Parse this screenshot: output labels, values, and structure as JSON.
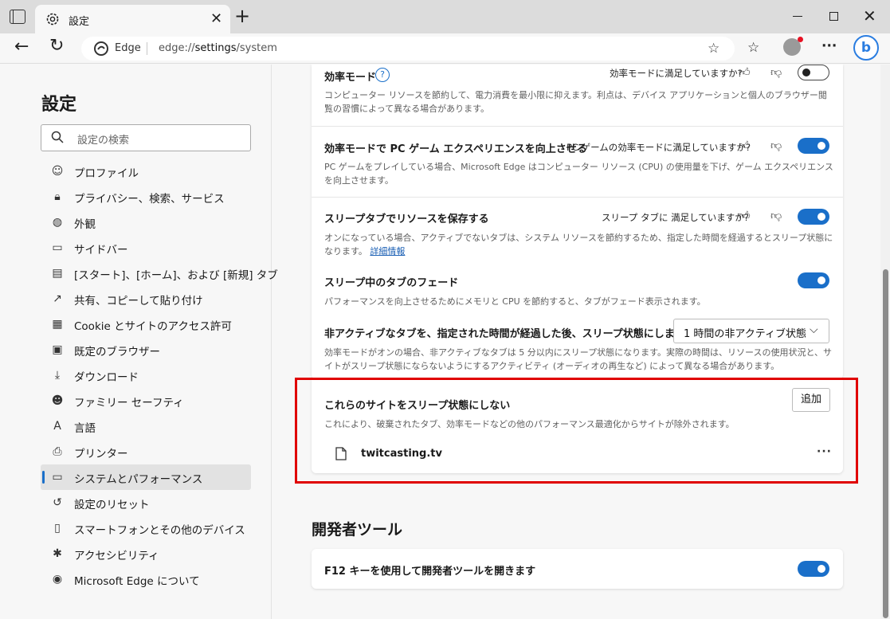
{
  "tab": {
    "title": "設定"
  },
  "address": {
    "site": "Edge",
    "url_prefix": "edge://",
    "url_main": "settings",
    "url_suffix": "/system"
  },
  "sidebar": {
    "title": "設定",
    "search_placeholder": "設定の検索",
    "items": [
      {
        "label": "プロファイル",
        "icon": "profile-icon"
      },
      {
        "label": "プライバシー、検索、サービス",
        "icon": "lock-icon"
      },
      {
        "label": "外観",
        "icon": "palette-icon"
      },
      {
        "label": "サイドバー",
        "icon": "sidebar-icon"
      },
      {
        "label": "[スタート]、[ホーム]、および [新規] タブ",
        "icon": "home-tabs-icon"
      },
      {
        "label": "共有、コピーして貼り付け",
        "icon": "share-icon"
      },
      {
        "label": "Cookie とサイトのアクセス許可",
        "icon": "cookie-icon"
      },
      {
        "label": "既定のブラウザー",
        "icon": "browser-icon"
      },
      {
        "label": "ダウンロード",
        "icon": "download-icon"
      },
      {
        "label": "ファミリー セーフティ",
        "icon": "family-icon"
      },
      {
        "label": "言語",
        "icon": "language-icon"
      },
      {
        "label": "プリンター",
        "icon": "printer-icon"
      },
      {
        "label": "システムとパフォーマンス",
        "icon": "system-icon",
        "active": true
      },
      {
        "label": "設定のリセット",
        "icon": "reset-icon"
      },
      {
        "label": "スマートフォンとその他のデバイス",
        "icon": "phone-icon"
      },
      {
        "label": "アクセシビリティ",
        "icon": "accessibility-icon"
      },
      {
        "label": "Microsoft Edge について",
        "icon": "edge-icon"
      }
    ]
  },
  "efficiency": {
    "title": "効率モード",
    "question": "効率モードに満足していますか?",
    "desc": "コンピューター リソースを節約して、電力消費を最小限に抑えます。利点は、デバイス アプリケーションと個人のブラウザー閲覧の習慣によって異なる場合があります。",
    "enabled": false
  },
  "gaming": {
    "title": "効率モードで PC ゲーム エクスペリエンスを向上させる",
    "question": "PC ゲームの効率モードに満足していますか?",
    "desc": "PC ゲームをプレイしている場合、Microsoft Edge はコンピューター リソース (CPU) の使用量を下げ、ゲーム エクスペリエンスを向上させます。",
    "enabled": true
  },
  "sleeping_tabs": {
    "title": "スリープタブでリソースを保存する",
    "question": "スリープ タブに 満足していますか?",
    "desc": "オンになっている場合、アクティブでないタブは、システム リソースを節約するため、指定した時間を経過するとスリープ状態になります。",
    "link": "詳細情報",
    "enabled": true
  },
  "fade": {
    "title": "スリープ中のタブのフェード",
    "desc": "パフォーマンスを向上させるためにメモリと CPU を節約すると、タブがフェード表示されます。",
    "enabled": true
  },
  "inactive": {
    "title": "非アクティブなタブを、指定された時間が経過した後、スリープ状態にします:",
    "selected": "1 時間の非アクティブ状態",
    "desc": "効率モードがオンの場合、非アクティブなタブは 5 分以内にスリープ状態になります。実際の時間は、リソースの使用状況と、サイトがスリープ状態にならないようにするアクティビティ (オーディオの再生など) によって異なる場合があります。"
  },
  "never_sleep": {
    "title": "これらのサイトをスリープ状態にしない",
    "desc": "これにより、破棄されたタブ、効率モードなどの他のパフォーマンス最適化からサイトが除外されます。",
    "add_label": "追加",
    "sites": [
      "twitcasting.tv"
    ],
    "more_label": "···"
  },
  "devtools": {
    "heading": "開発者ツール",
    "f12_label": "F12 キーを使用して開発者ツールを開きます",
    "enabled": true
  },
  "colors": {
    "accent": "#1a6fc9",
    "highlight": "#e00000"
  }
}
